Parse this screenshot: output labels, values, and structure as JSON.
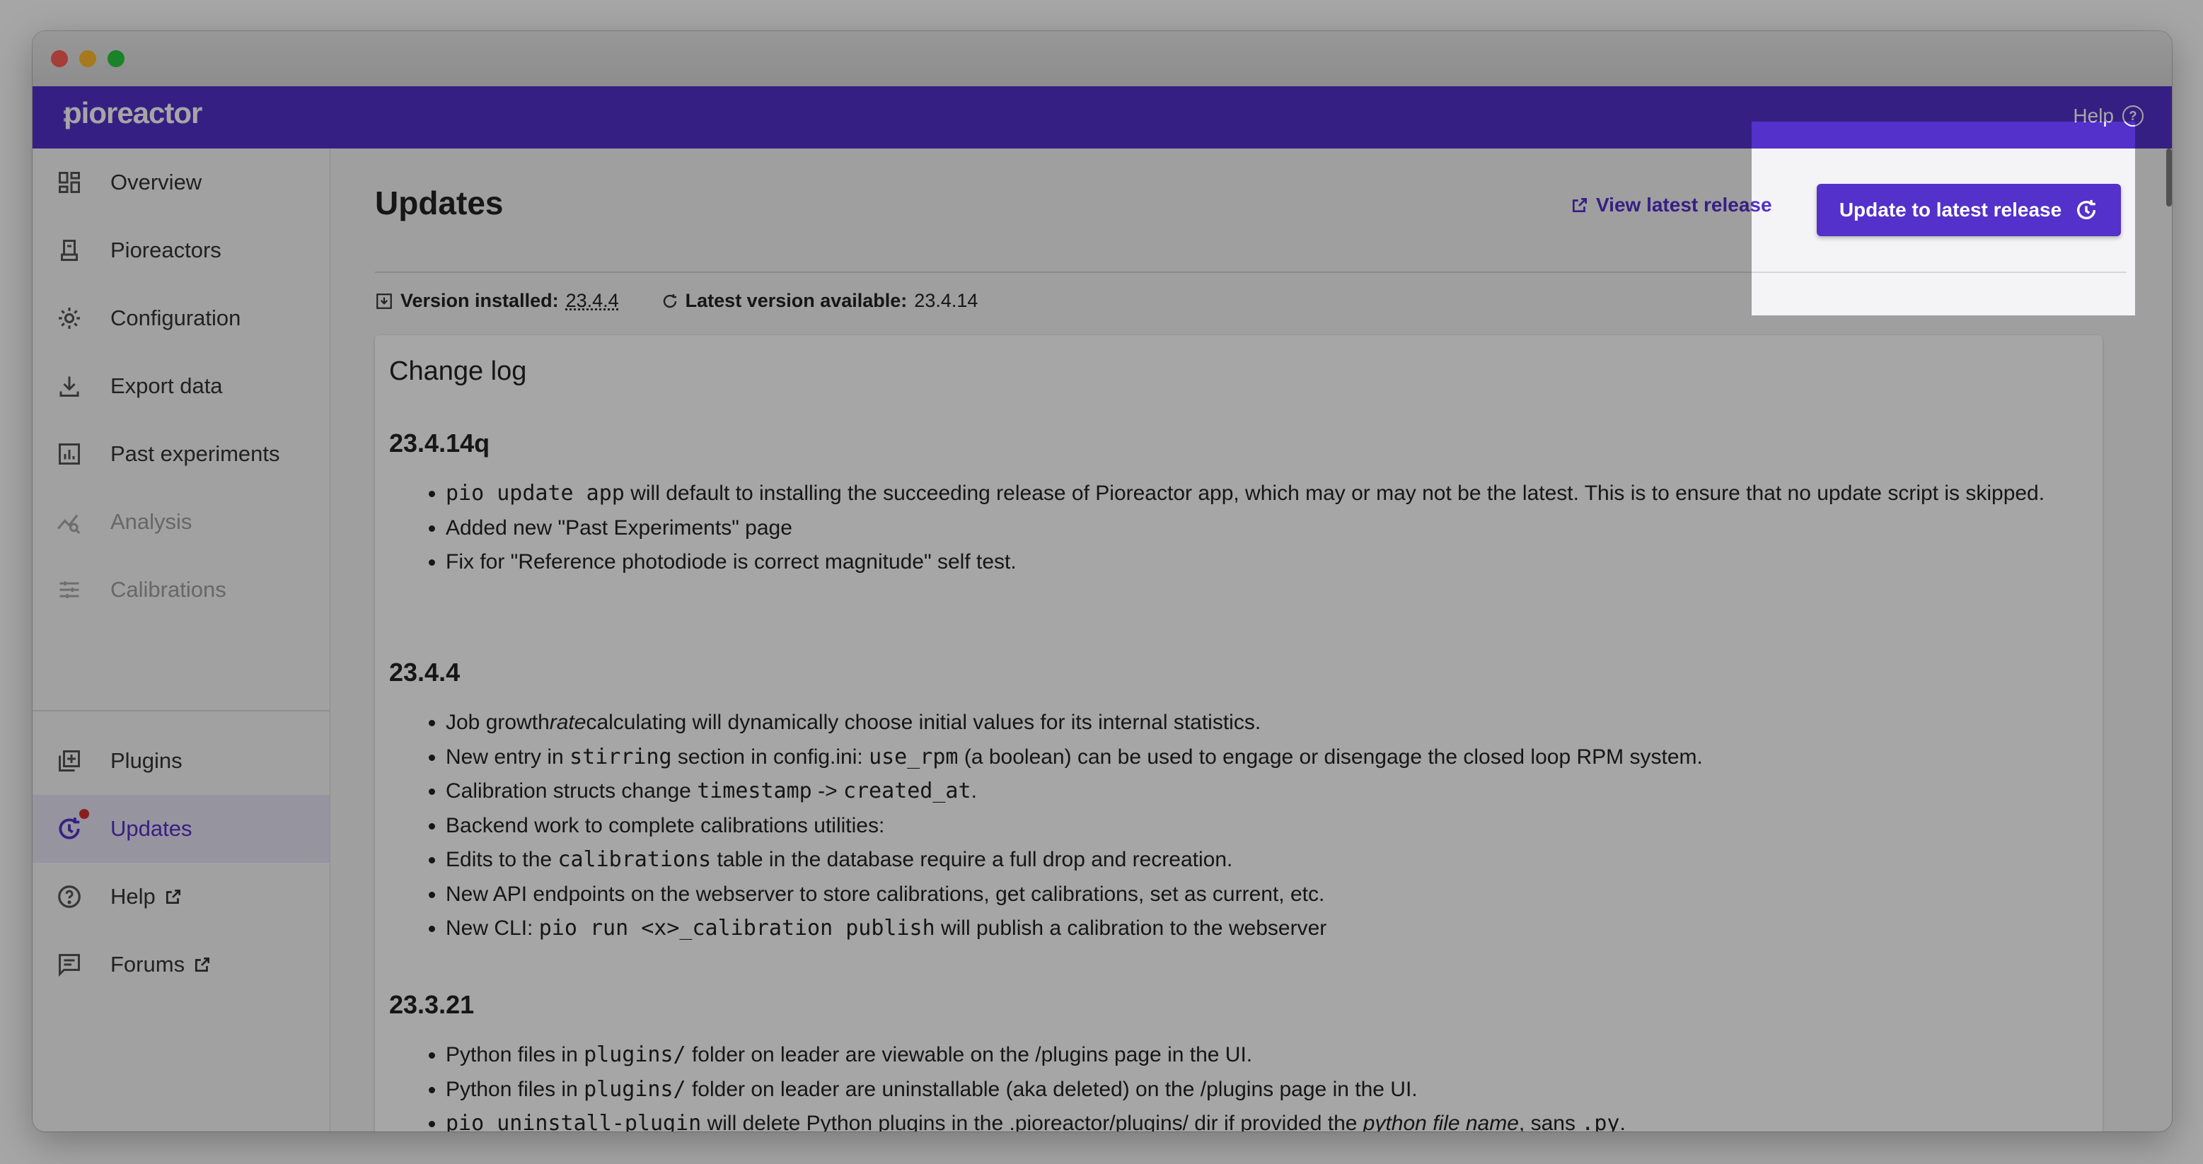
{
  "app": {
    "logo_text": "pioreactor",
    "help_label": "Help"
  },
  "sidebar": {
    "items": [
      {
        "label": "Overview",
        "icon": "grid-icon"
      },
      {
        "label": "Pioreactors",
        "icon": "bioreactor-icon"
      },
      {
        "label": "Configuration",
        "icon": "gear-icon"
      },
      {
        "label": "Export data",
        "icon": "download-icon"
      },
      {
        "label": "Past experiments",
        "icon": "bar-chart-icon"
      },
      {
        "label": "Analysis",
        "icon": "analysis-icon",
        "disabled": true
      },
      {
        "label": "Calibrations",
        "icon": "sliders-icon",
        "disabled": true
      },
      {
        "label": "Plugins",
        "icon": "add-box-icon"
      },
      {
        "label": "Updates",
        "icon": "update-icon",
        "active": true,
        "badge": true
      },
      {
        "label": "Help",
        "icon": "help-circle-icon",
        "external": true
      },
      {
        "label": "Forums",
        "icon": "forum-icon",
        "external": true
      }
    ]
  },
  "page": {
    "title": "Updates",
    "view_release_label": "View latest release",
    "update_button_label": "Update to latest release",
    "version_installed_label": "Version installed:",
    "version_installed_value": "23.4.4",
    "latest_version_label": "Latest version available:",
    "latest_version_value": "23.4.14"
  },
  "changelog": {
    "title": "Change log",
    "sections": [
      {
        "version": "23.4.14q"
      },
      {
        "version": "23.4.4"
      },
      {
        "version": "23.3.21"
      }
    ],
    "s1": {
      "b1_code": "pio update app",
      "b1_text": " will default to installing the succeeding release of Pioreactor app, which may or may not be the latest. This is to ensure that no update script is skipped.",
      "b2": "Added new \"Past Experiments\" page",
      "b3": "Fix for \"Reference photodiode is correct magnitude\" self test."
    },
    "s2": {
      "b1_pre": "Job growth",
      "b1_em": "rate",
      "b1_post": "calculating will dynamically choose initial values for its internal statistics.",
      "b2_pre": "New entry in ",
      "b2_code1": "stirring",
      "b2_mid": " section in config.ini: ",
      "b2_code2": "use_rpm",
      "b2_post": " (a boolean) can be used to engage or disengage the closed loop RPM system.",
      "b3_pre": "Calibration structs change ",
      "b3_code1": "timestamp",
      "b3_mid": " -> ",
      "b3_code2": "created_at",
      "b3_post": ".",
      "b4": "Backend work to complete calibrations utilities:",
      "b5_pre": "Edits to the ",
      "b5_code": "calibrations",
      "b5_post": " table in the database require a full drop and recreation.",
      "b6": "New API endpoints on the webserver to store calibrations, get calibrations, set as current, etc.",
      "b7_pre": "New CLI: ",
      "b7_code": "pio run <x>_calibration publish",
      "b7_post": " will publish a calibration to the webserver"
    },
    "s3": {
      "b1_pre": "Python files in ",
      "b1_code": "plugins/",
      "b1_post": " folder on leader are viewable on the /plugins page in the UI.",
      "b2_pre": "Python files in ",
      "b2_code": "plugins/",
      "b2_post": " folder on leader are uninstallable (aka deleted) on the /plugins page in the UI.",
      "b3_code": "pio uninstall-plugin",
      "b3_mid": " will delete Python plugins in the .pioreactor/plugins/ dir if provided the ",
      "b3_em": "python file name",
      "b3_post2": ", sans ",
      "b3_code2": ".py",
      "b3_end": "."
    }
  }
}
